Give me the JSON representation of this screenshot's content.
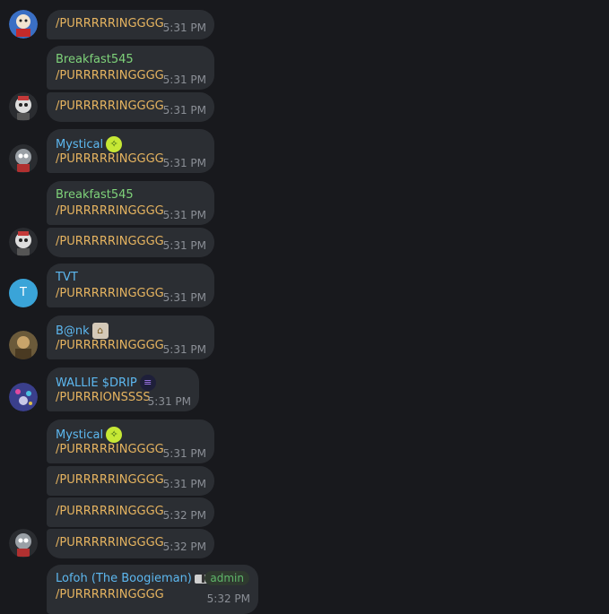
{
  "messages": [
    {
      "text": "/PURRRRRINGGGG",
      "time": "5:31 PM"
    },
    {
      "sender": "Breakfast545",
      "text": "/PURRRRRINGGGG",
      "time": "5:31 PM"
    },
    {
      "text": "/PURRRRRINGGGG",
      "time": "5:31 PM"
    },
    {
      "sender": "Mystical",
      "text": "/PURRRRRINGGGG",
      "time": "5:31 PM"
    },
    {
      "sender": "Breakfast545",
      "text": "/PURRRRRINGGGG",
      "time": "5:31 PM"
    },
    {
      "text": "/PURRRRRINGGGG",
      "time": "5:31 PM"
    },
    {
      "sender": "TVT",
      "text": "/PURRRRRINGGGG",
      "time": "5:31 PM",
      "avatar_letter": "T"
    },
    {
      "sender": "B@nk",
      "text": "/PURRRRRINGGGG",
      "time": "5:31 PM"
    },
    {
      "sender": "WALLIE $DRIP",
      "text": "/PURRRIONSSSS",
      "time": "5:31 PM"
    },
    {
      "sender": "Mystical",
      "text": "/PURRRRRINGGGG",
      "time": "5:31 PM"
    },
    {
      "text": "/PURRRRRINGGGG",
      "time": "5:31 PM"
    },
    {
      "text": "/PURRRRRINGGGG",
      "time": "5:32 PM"
    },
    {
      "text": "/PURRRRRINGGGG",
      "time": "5:32 PM"
    },
    {
      "sender": "Lofoh (The Boogieman)",
      "text": "/PURRRRRINGGGG",
      "time": "5:32 PM",
      "badge": "admin"
    }
  ],
  "colors": {
    "background": "#18191d",
    "bubble": "#2b2e33",
    "message_text": "#e6b460",
    "timestamp": "#8b8f96",
    "sender_green": "#7fd37a",
    "sender_blue": "#5db8f0",
    "admin_green": "#5fb76a"
  },
  "icons": {
    "mystical_emoji": "green-leaf-badge-icon",
    "bank_emoji": "bank-building-icon",
    "wallie_emoji": "purple-stack-coin-icon",
    "lofoh_emoji": "small-banner-icon"
  }
}
